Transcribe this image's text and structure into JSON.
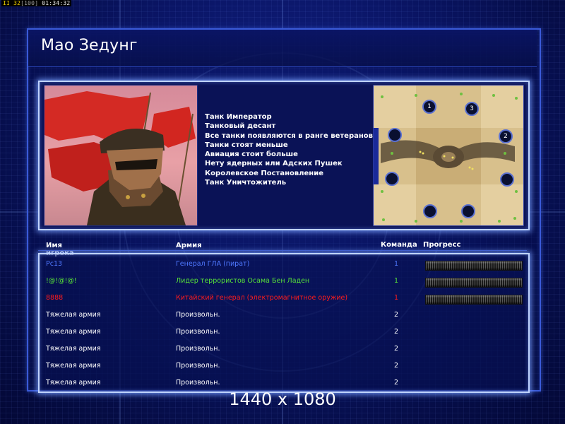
{
  "debug": {
    "fps_label": "II",
    "fps": "32",
    "limit": "[100]",
    "time": "01:34:32"
  },
  "title": "Мао Зедунг",
  "bonuses": [
    "Танк Император",
    "Танковый десант",
    "Все танки появляются в ранге ветеранов",
    "Танки стоят меньше",
    "Авиация стоит больше",
    "Нету ядерных или Адских Пушек",
    "Королевское Постановление",
    "Танк Уничтожитель"
  ],
  "minimap": {
    "start_labels": [
      "1",
      "3",
      "2"
    ]
  },
  "table": {
    "headers": {
      "player": "Имя игрока",
      "army": "Армия",
      "team": "Команда",
      "progress": "Прогресс"
    },
    "rows": [
      {
        "player": "Pc13",
        "army": "Генерал ГЛА (пират)",
        "team": "1",
        "color": "#4f78ff",
        "progress": 1.0
      },
      {
        "player": "!@!@!@!",
        "army": "Лидер террористов Осама Бен Ладен",
        "team": "1",
        "color": "#57e038",
        "progress": 1.0
      },
      {
        "player": "8888",
        "army": "Китайский генерал (электромагнитное оружие)",
        "team": "1",
        "color": "#ff1c1c",
        "progress": 1.0
      },
      {
        "player": "Тяжелая армия",
        "army": "Произвольн.",
        "team": "2",
        "color": "#ffffff"
      },
      {
        "player": "Тяжелая армия",
        "army": "Произвольн.",
        "team": "2",
        "color": "#ffffff"
      },
      {
        "player": "Тяжелая армия",
        "army": "Произвольн.",
        "team": "2",
        "color": "#ffffff"
      },
      {
        "player": "Тяжелая армия",
        "army": "Произвольн.",
        "team": "2",
        "color": "#ffffff"
      },
      {
        "player": "Тяжелая армия",
        "army": "Произвольн.",
        "team": "2",
        "color": "#ffffff"
      }
    ]
  },
  "resolution": "1440 x 1080"
}
